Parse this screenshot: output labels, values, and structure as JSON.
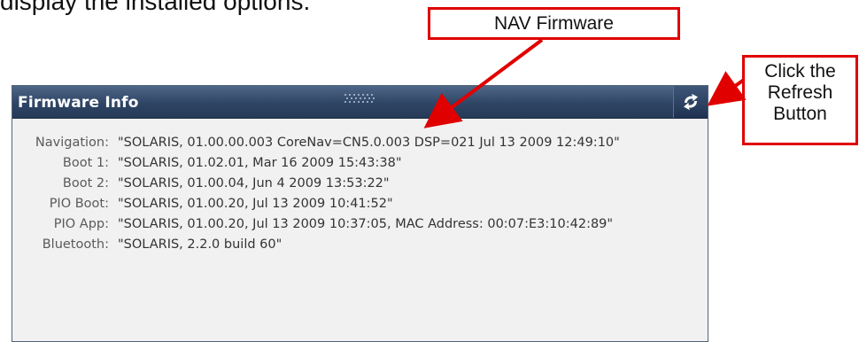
{
  "intro": {
    "text": "display the installed options."
  },
  "callouts": {
    "nav_firmware": "NAV Firmware",
    "refresh_lines": [
      "Click the",
      "Refresh",
      "Button"
    ]
  },
  "panel": {
    "title": "Firmware Info",
    "rows": [
      {
        "label": "Navigation:",
        "value": "\"SOLARIS, 01.00.00.003 CoreNav=CN5.0.003 DSP=021 Jul 13 2009 12:49:10\""
      },
      {
        "label": "Boot 1:",
        "value": "\"SOLARIS, 01.02.01, Mar 16 2009 15:43:38\""
      },
      {
        "label": "Boot 2:",
        "value": "\"SOLARIS, 01.00.04, Jun 4 2009 13:53:22\""
      },
      {
        "label": "PIO Boot:",
        "value": "\"SOLARIS, 01.00.20, Jul 13 2009 10:41:52\""
      },
      {
        "label": "PIO App:",
        "value": "\"SOLARIS, 01.00.20, Jul 13 2009 10:37:05, MAC Address: 00:07:E3:10:42:89\""
      },
      {
        "label": "Bluetooth:",
        "value": "\"SOLARIS, 2.2.0 build 60\""
      }
    ]
  },
  "colors": {
    "callout_border": "#e00000",
    "arrow": "#e00000",
    "header_top": "#4e6688",
    "header_bottom": "#263a58"
  },
  "icons": {
    "refresh": "refresh-icon",
    "grip": "grip-handle-icon"
  }
}
